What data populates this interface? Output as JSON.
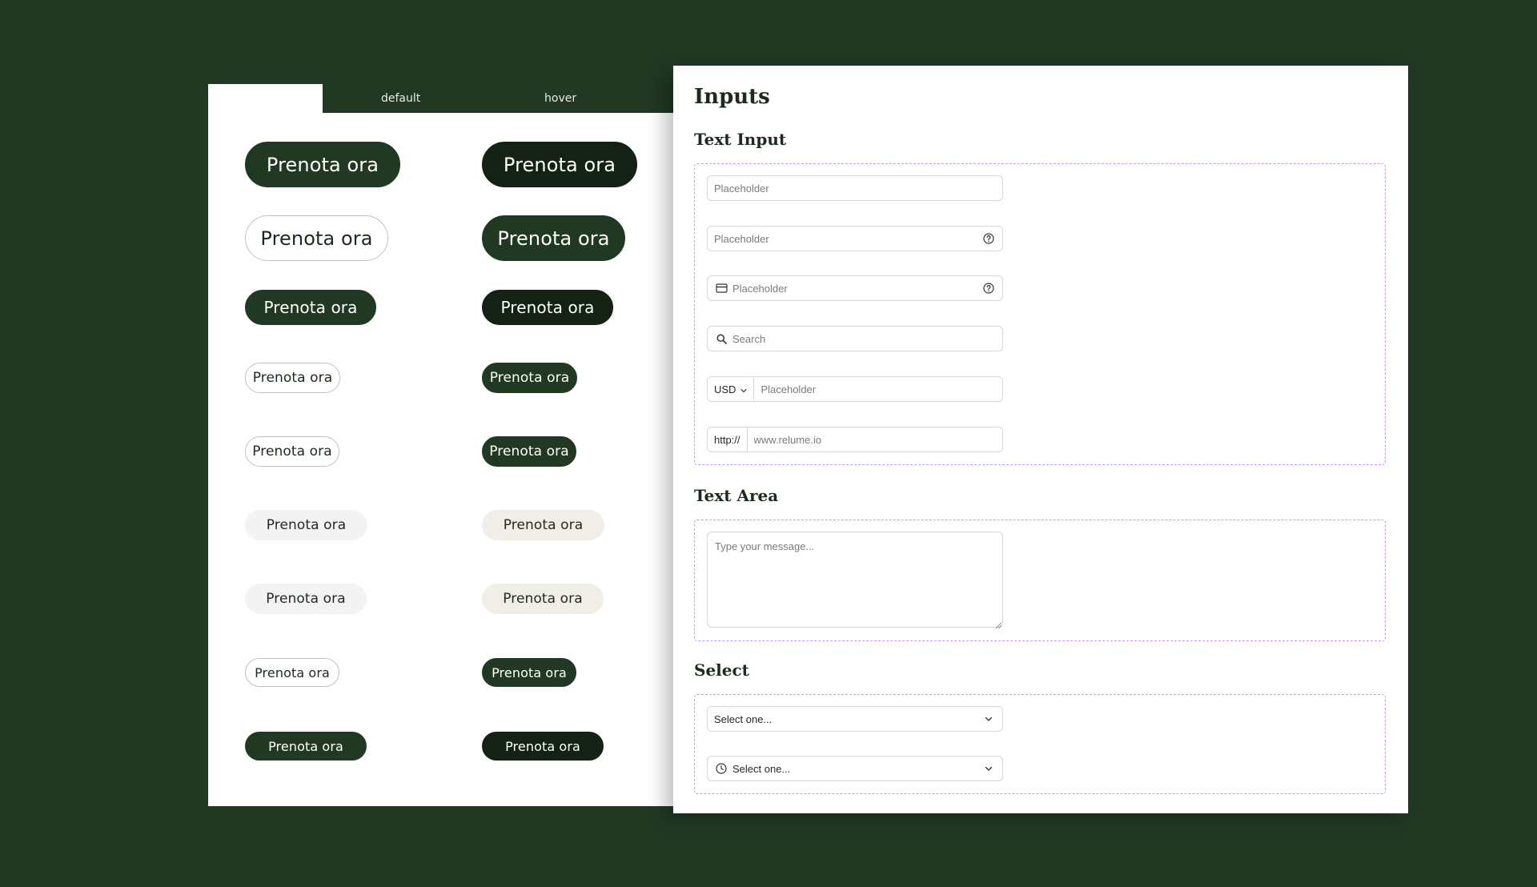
{
  "columns": {
    "default": "default",
    "hover": "hover"
  },
  "button_label": "Prenota ora",
  "inputs_panel": {
    "title": "Inputs",
    "text_input": {
      "heading": "Text Input",
      "plain_placeholder": "Placeholder",
      "help_placeholder": "Placeholder",
      "card_placeholder": "Placeholder",
      "search_placeholder": "Search",
      "currency": "USD",
      "currency_placeholder": "Placeholder",
      "url_prefix": "http://",
      "url_placeholder": "www.relume.io"
    },
    "text_area": {
      "heading": "Text Area",
      "placeholder": "Type your message..."
    },
    "select": {
      "heading": "Select",
      "value_1": "Select one...",
      "value_2": "Select one..."
    }
  },
  "colors": {
    "background": "#213823",
    "button_dark": "#213823",
    "button_hover": "#132214",
    "button_soft": "#f3f3f3",
    "button_soft_hover": "#f1ede7",
    "dashed_outline": "#c39cf0"
  },
  "icons": [
    "help-circle-icon",
    "credit-card-icon",
    "search-icon",
    "chevron-down-icon",
    "clock-icon",
    "resize-grip-icon"
  ]
}
